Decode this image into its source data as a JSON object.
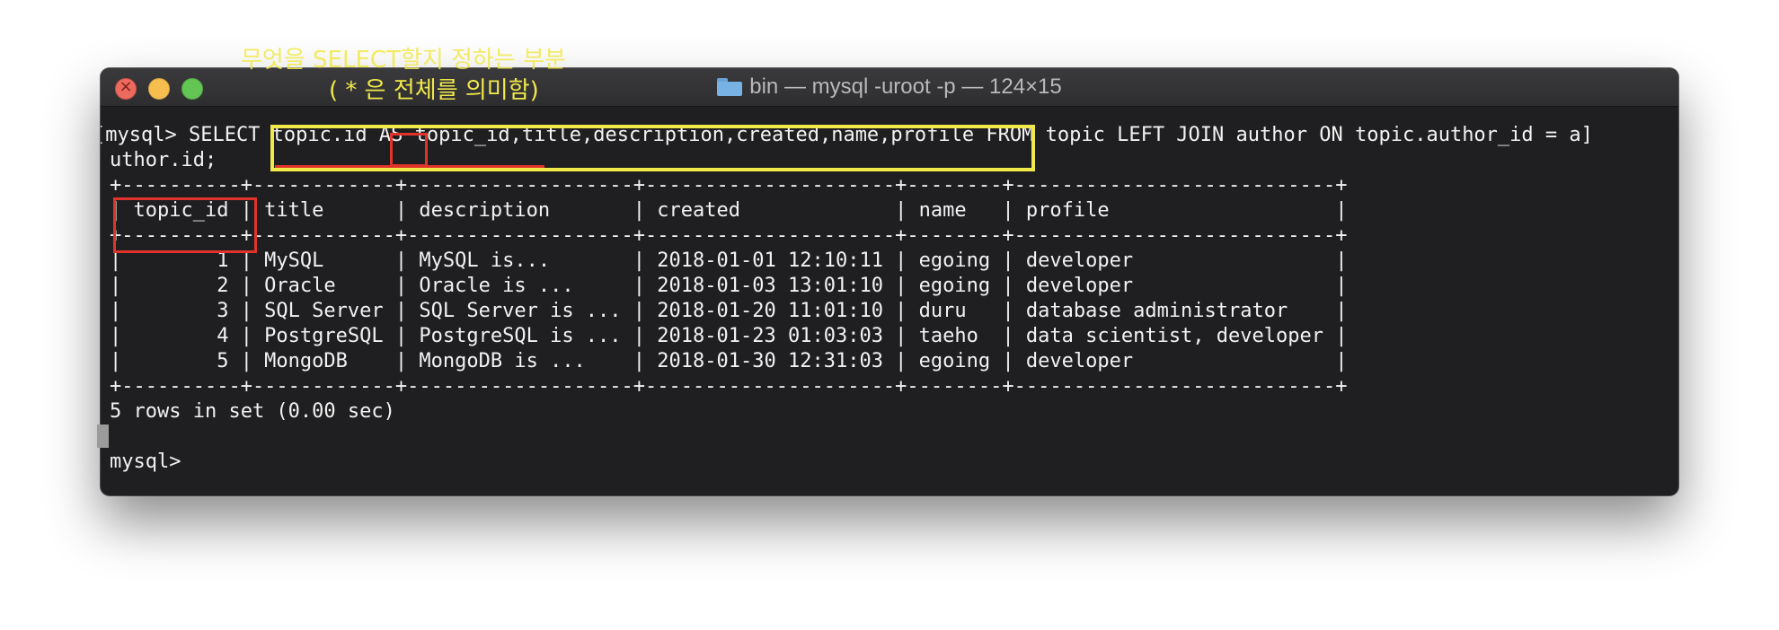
{
  "annotation": {
    "line1": "무엇을 SELECT할지 정하는 부분",
    "line2": "( * 은 전체를 의미함)",
    "color": "#f1e94a",
    "highlight_color": "#e0342a"
  },
  "window": {
    "title": "bin — mysql -uroot -p — 124×15",
    "folder_icon": "folder-icon",
    "controls": [
      "close-button",
      "minimize-button",
      "zoom-button"
    ]
  },
  "terminal": {
    "lines": [
      "[mysql> SELECT topic.id AS topic_id,title,description,created,name,profile FROM topic LEFT JOIN author ON topic.author_id = a]",
      "uthor.id;",
      "+----------+------------+-------------------+---------------------+--------+---------------------------+",
      "| topic_id | title      | description       | created             | name   | profile                   |",
      "+----------+------------+-------------------+---------------------+--------+---------------------------+",
      "|        1 | MySQL      | MySQL is...       | 2018-01-01 12:10:11 | egoing | developer                 |",
      "|        2 | Oracle     | Oracle is ...     | 2018-01-03 13:01:10 | egoing | developer                 |",
      "|        3 | SQL Server | SQL Server is ... | 2018-01-20 11:01:10 | duru   | database administrator    |",
      "|        4 | PostgreSQL | PostgreSQL is ... | 2018-01-23 01:03:03 | taeho  | data scientist, developer |",
      "|        5 | MongoDB    | MongoDB is ...    | 2018-01-30 12:31:03 | egoing | developer                 |",
      "+----------+------------+-------------------+---------------------+--------+---------------------------+",
      "5 rows in set (0.00 sec)",
      "",
      "mysql> "
    ]
  }
}
